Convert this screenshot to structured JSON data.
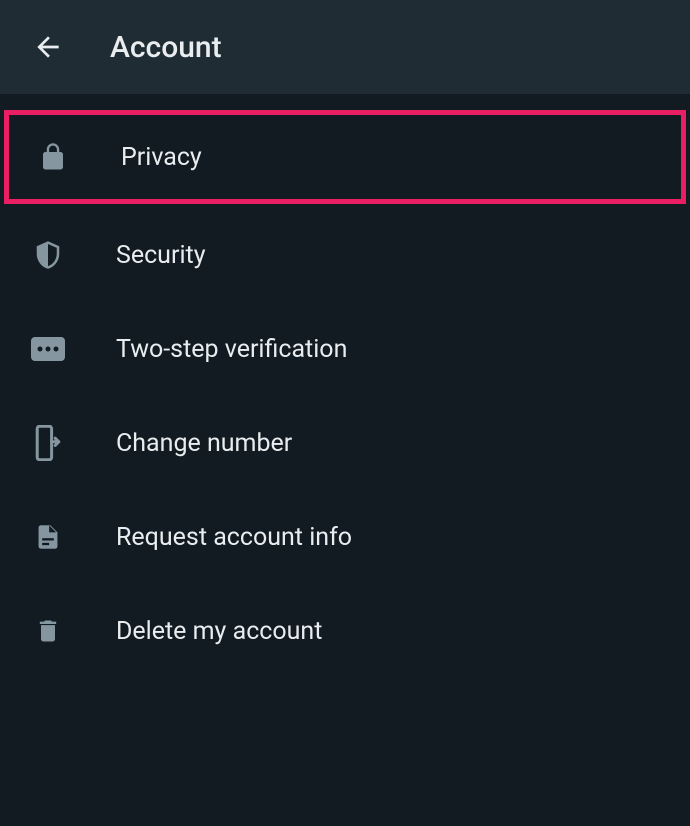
{
  "header": {
    "title": "Account"
  },
  "menu": {
    "items": [
      {
        "label": "Privacy",
        "icon": "lock-icon",
        "highlighted": true
      },
      {
        "label": "Security",
        "icon": "shield-icon",
        "highlighted": false
      },
      {
        "label": "Two-step verification",
        "icon": "dots-icon",
        "highlighted": false
      },
      {
        "label": "Change number",
        "icon": "change-icon",
        "highlighted": false
      },
      {
        "label": "Request account info",
        "icon": "document-icon",
        "highlighted": false
      },
      {
        "label": "Delete my account",
        "icon": "trash-icon",
        "highlighted": false
      }
    ]
  }
}
